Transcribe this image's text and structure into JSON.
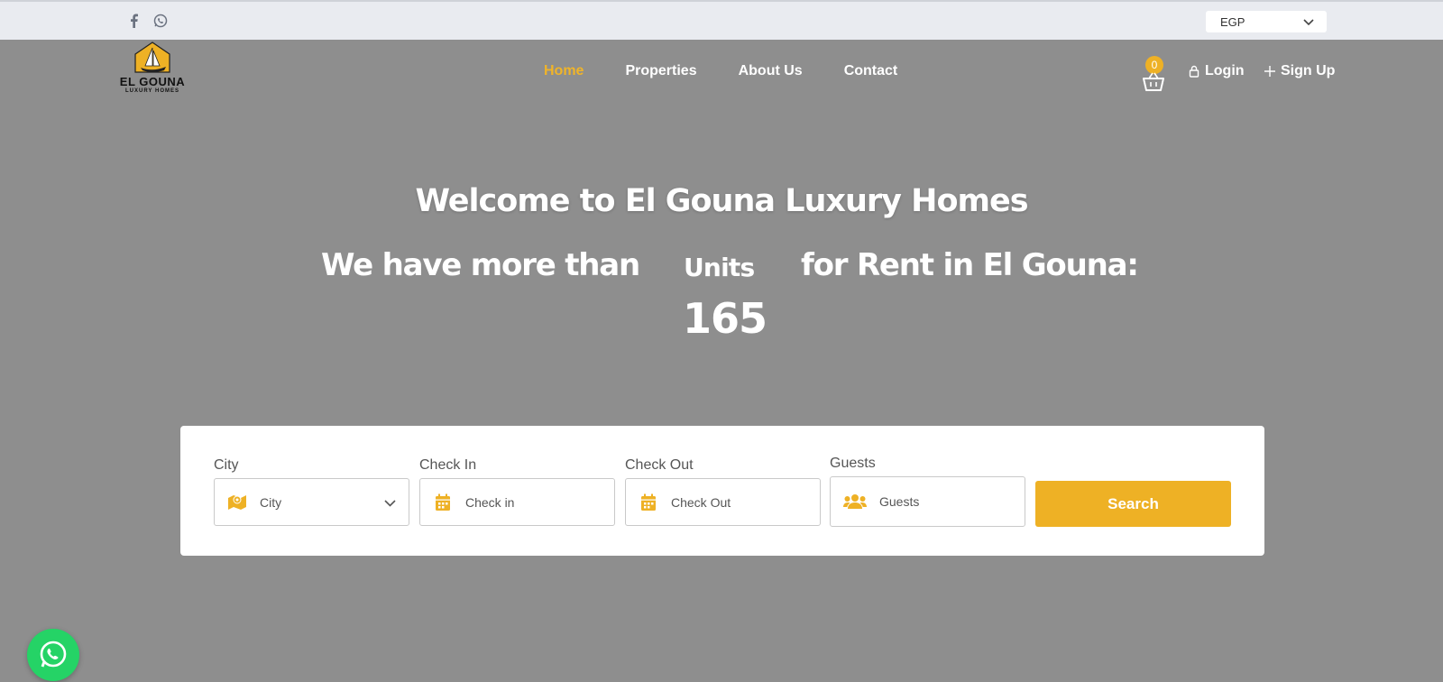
{
  "topbar": {
    "social_icons": [
      "facebook-icon",
      "whatsapp-icon"
    ],
    "currency": {
      "selected": "EGP"
    }
  },
  "brand": {
    "name": "EL GOUNA",
    "tagline": "LUXURY HOMES"
  },
  "nav": {
    "items": [
      {
        "label": "Home",
        "active": true
      },
      {
        "label": "Properties",
        "active": false
      },
      {
        "label": "About Us",
        "active": false
      },
      {
        "label": "Contact",
        "active": false
      }
    ]
  },
  "cart": {
    "count": "0"
  },
  "auth": {
    "login": "Login",
    "signup": "Sign Up"
  },
  "hero": {
    "title": "Welcome to El Gouna Luxury Homes",
    "line_left": "We have more than",
    "units_label": "Units",
    "units_count": "165",
    "line_right": "for Rent in El Gouna:"
  },
  "search": {
    "city": {
      "label": "City",
      "value": "City"
    },
    "check_in": {
      "label": "Check In",
      "placeholder": "Check in"
    },
    "check_out": {
      "label": "Check Out",
      "placeholder": "Check Out"
    },
    "guests": {
      "label": "Guests",
      "placeholder": "Guests"
    },
    "button": "Search"
  },
  "colors": {
    "accent": "#eeb125",
    "overlay": "#8e8e8e",
    "whatsapp": "#25d366"
  }
}
